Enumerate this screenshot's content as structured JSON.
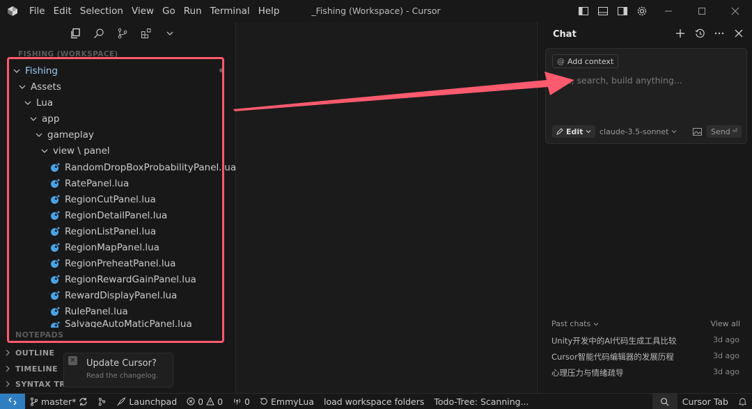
{
  "window": {
    "title": "_Fishing (Workspace) - Cursor",
    "menu": [
      "File",
      "Edit",
      "Selection",
      "View",
      "Go",
      "Run",
      "Terminal",
      "Help"
    ]
  },
  "sidebar": {
    "ghost_header": "FISHING (WORKSPACE)",
    "tree": {
      "root": "Fishing",
      "folders": [
        "Assets",
        "Lua",
        "app",
        "gameplay",
        "view \\ panel"
      ],
      "files": [
        "RandomDropBoxProbabilityPanel.lua",
        "RatePanel.lua",
        "RegionCutPanel.lua",
        "RegionDetailPanel.lua",
        "RegionListPanel.lua",
        "RegionMapPanel.lua",
        "RegionPreheatPanel.lua",
        "RegionRewardGainPanel.lua",
        "RewardDisplayPanel.lua",
        "RulePanel.lua",
        "SalvageAutoMaticPanel.lua"
      ]
    },
    "sections": [
      "NOTEPADS",
      "OUTLINE",
      "TIMELINE",
      "SYNTAX TREE"
    ],
    "highlight_color": "#ff5a6e"
  },
  "notification": {
    "title": "Update Cursor?",
    "subtitle": "Read the changelog."
  },
  "chat": {
    "title": "Chat",
    "add_context": "Add context",
    "placeholder": "Plan, search, build anything...",
    "mode": "Edit",
    "model": "claude-3.5-sonnet",
    "send": "Send",
    "past_header": "Past chats",
    "view_all": "View all",
    "past_chats": [
      {
        "title": "Unity开发中的AI代码生成工具比较",
        "time": "3d ago"
      },
      {
        "title": "Cursor智能代码编辑器的发展历程",
        "time": "3d ago"
      },
      {
        "title": "心理压力与情绪疏导",
        "time": "3d ago"
      }
    ]
  },
  "statusbar": {
    "branch": "master*",
    "launchpad": "Launchpad",
    "errors": "0",
    "warnings": "0",
    "ports": "0",
    "lang": "EmmyLua",
    "load": "load workspace folders",
    "todo": "Todo-Tree: Scanning...",
    "cursor_tab": "Cursor Tab",
    "accent": "#2f7ec2"
  }
}
